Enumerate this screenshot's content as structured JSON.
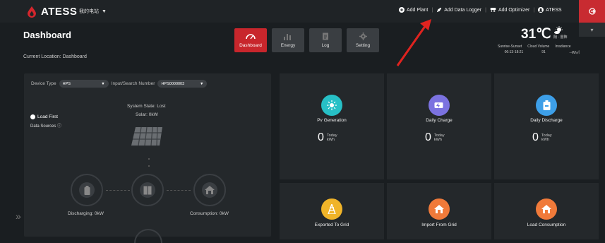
{
  "header": {
    "brand": "ATESS",
    "site": "我的电站",
    "links": {
      "add_plant": "Add Plant",
      "add_logger": "Add Data Logger",
      "add_optimizer": "Add Optimizer",
      "user": "ATESS"
    }
  },
  "page": {
    "title": "Dashboard",
    "location": "Current Location: Dashboard"
  },
  "nav": [
    {
      "label": "Dashboard",
      "icon": "gauge-icon",
      "active": true
    },
    {
      "label": "Energy",
      "icon": "bar-chart-icon",
      "active": false
    },
    {
      "label": "Log",
      "icon": "document-icon",
      "active": false
    },
    {
      "label": "Setting",
      "icon": "gear-icon",
      "active": false
    }
  ],
  "weather": {
    "temp": "31℃",
    "desc": "阴 · 雷阵",
    "labels": [
      "Sunrise-Sunset",
      "Cloud Volume",
      "Irradiance"
    ],
    "values": [
      "06:13-18:21",
      "91",
      "--W/㎡"
    ]
  },
  "device": {
    "type_label": "Device Type",
    "type_value": "HPS",
    "search_label": "Input/Search Number",
    "search_value": "HPS0000003",
    "load_first": "Load First",
    "data_sources": "Data Sources ⓘ",
    "system_state": "System State:  Lost",
    "solar": "Solar:  0kW",
    "discharging": "Discharging:  0kW",
    "consumption": "Consumption:  0kW"
  },
  "cards": [
    {
      "title": "Pv Generation",
      "value": "0",
      "unit_top": "Today",
      "unit_bottom": "kWh",
      "color": "#27c0c6"
    },
    {
      "title": "Daily Charge",
      "value": "0",
      "unit_top": "Today",
      "unit_bottom": "kWh",
      "color": "#7b72e0"
    },
    {
      "title": "Daily Discharge",
      "value": "0",
      "unit_top": "Today",
      "unit_bottom": "kWh",
      "color": "#3d9fe8"
    }
  ],
  "cards_bottom": [
    {
      "title": "Exported To Grid",
      "color": "#f0b429"
    },
    {
      "title": "Import From Grid",
      "color": "#f07a3a"
    },
    {
      "title": "Load Consumption",
      "color": "#f07a3a"
    }
  ],
  "colors": {
    "accent": "#c8262c",
    "background": "#1a1e21",
    "panel": "#24282b"
  }
}
